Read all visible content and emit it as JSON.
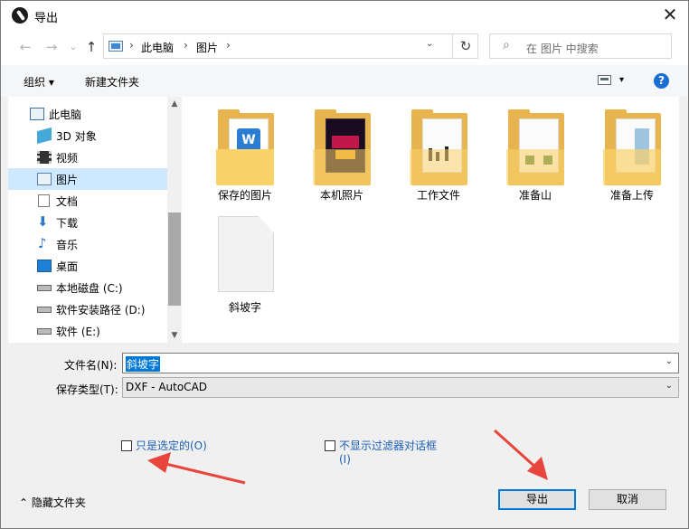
{
  "window": {
    "title": "导出",
    "close_glyph": "✕"
  },
  "nav_buttons": {
    "back": "←",
    "forward": "→",
    "dropdown": "⌄",
    "up": "↑"
  },
  "address": {
    "crumbs": [
      "此电脑",
      "图片"
    ],
    "separator": "›",
    "dropdown_glyph": "⌄",
    "refresh_glyph": "↻"
  },
  "search": {
    "placeholder": "在 图片 中搜索",
    "icon_glyph": "⌕"
  },
  "toolbar": {
    "organize": "组织 ▾",
    "new_folder": "新建文件夹",
    "view_arrow": "▾",
    "help": "?"
  },
  "nav_tree": {
    "items": [
      {
        "label": "此电脑",
        "icon": "computer-icon"
      },
      {
        "label": "3D 对象",
        "icon": "cube-icon"
      },
      {
        "label": "视频",
        "icon": "video-icon"
      },
      {
        "label": "图片",
        "icon": "pictures-icon",
        "selected": true
      },
      {
        "label": "文档",
        "icon": "document-icon"
      },
      {
        "label": "下载",
        "icon": "download-icon"
      },
      {
        "label": "音乐",
        "icon": "music-icon"
      },
      {
        "label": "桌面",
        "icon": "desktop-icon"
      },
      {
        "label": "本地磁盘 (C:)",
        "icon": "drive-icon"
      },
      {
        "label": "软件安装路径 (D:)",
        "icon": "drive-icon"
      },
      {
        "label": "软件 (E:)",
        "icon": "drive-icon"
      }
    ],
    "scroll_up": "▲",
    "scroll_down": "▼"
  },
  "files": [
    {
      "name": "保存的图片",
      "type": "folder"
    },
    {
      "name": "本机照片",
      "type": "folder"
    },
    {
      "name": "工作文件",
      "type": "folder"
    },
    {
      "name": "准备山",
      "type": "folder"
    },
    {
      "name": "准备上传",
      "type": "folder"
    },
    {
      "name": "斜坡字",
      "type": "file"
    }
  ],
  "form": {
    "filename_label": "文件名(N):",
    "filename_value": "斜坡字",
    "filetype_label": "保存类型(T):",
    "filetype_value": "DXF - AutoCAD",
    "combo_arrow": "⌄"
  },
  "options": {
    "selected_only": "只是选定的(O)",
    "no_filter_line1": "不显示过滤器对话框",
    "no_filter_line2": "(I)"
  },
  "footer": {
    "hide_folders": "隐藏文件夹",
    "hide_glyph": "⌃",
    "export": "导出",
    "cancel": "取消"
  },
  "colors": {
    "accent": "#0078d7",
    "annotation_arrow": "#e8453c",
    "selection": "#cde8ff"
  }
}
